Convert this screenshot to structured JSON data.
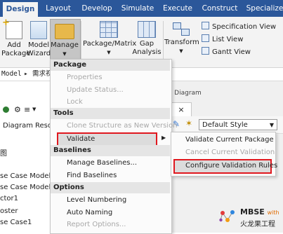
{
  "ribbon": {
    "tabs": [
      "Design",
      "Layout",
      "Develop",
      "Simulate",
      "Execute",
      "Construct",
      "Specialize"
    ],
    "active_tab": "Design",
    "buttons": {
      "add_package": [
        "Add",
        "Package"
      ],
      "model_wizard": [
        "Model",
        "Wizard"
      ],
      "manage": "Manage",
      "package_matrix": "Package/Matrix",
      "gap_analysis": [
        "Gap",
        "Analysis"
      ],
      "transform": "Transform",
      "specification_view": "Specification View",
      "list_view": "List View",
      "gantt_view": "Gantt View"
    }
  },
  "breadcrumb": {
    "root": "Model",
    "sep": "▸",
    "item": "需求视"
  },
  "left_panel": {
    "tabs": [
      "Diagram",
      "Reso"
    ],
    "tree": [
      "图",
      "se Case Model",
      "se Case Model",
      "ctor1",
      "oster",
      "se Case1"
    ]
  },
  "diagram": {
    "header": "y Diagram",
    "tab_close": "×",
    "style_select": "Default Style"
  },
  "manage_menu": {
    "sections": [
      {
        "title": "Package",
        "items": [
          {
            "label": "Properties",
            "enabled": false
          },
          {
            "label": "Update Status...",
            "enabled": false
          },
          {
            "label": "Lock",
            "enabled": false
          }
        ]
      },
      {
        "title": "Tools",
        "items": [
          {
            "label": "Clone Structure as New Version",
            "enabled": false
          },
          {
            "label": "Validate",
            "enabled": true,
            "has_submenu": true,
            "highlighted": true
          }
        ]
      },
      {
        "title": "Baselines",
        "items": [
          {
            "label": "Manage Baselines...",
            "enabled": true
          },
          {
            "label": "Find Baselines",
            "enabled": true
          }
        ]
      },
      {
        "title": "Options",
        "items": [
          {
            "label": "Level Numbering",
            "enabled": true
          },
          {
            "label": "Auto Naming",
            "enabled": true
          },
          {
            "label": "Report Options...",
            "enabled": false
          }
        ]
      }
    ]
  },
  "validate_submenu": {
    "items": [
      {
        "label": "Validate Current Package",
        "enabled": true
      },
      {
        "label": "Cancel Current Validation",
        "enabled": false
      },
      {
        "label": "Configure Validation Rules",
        "enabled": true,
        "highlighted": true
      }
    ]
  },
  "logo": {
    "line1": "MBSE",
    "with": "with",
    "line2": "火龙果工程"
  },
  "colors": {
    "ribbon_blue": "#2b579a",
    "highlight_red": "#e0181f",
    "menu_disabled": "#a8a8a8"
  }
}
